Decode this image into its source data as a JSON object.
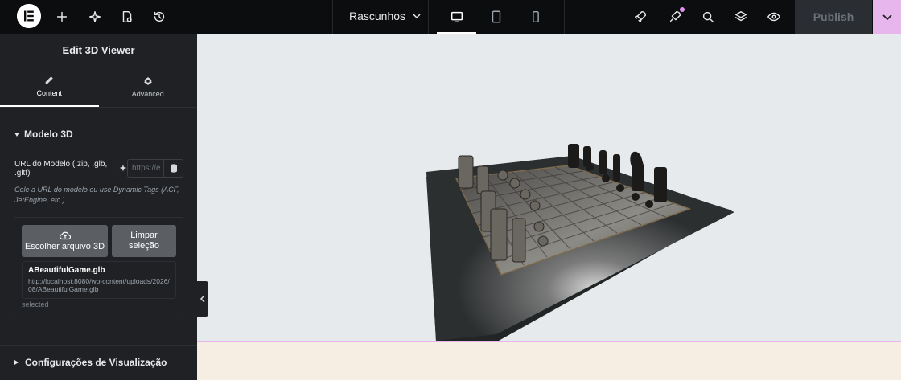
{
  "topbar": {
    "drafts_label": "Rascunhos",
    "publish_label": "Publish",
    "icons": [
      "elementor-logo-icon",
      "add-icon",
      "ai-sparkle-icon",
      "page-settings-icon",
      "history-icon",
      "drafts-chevron-icon",
      "desktop-icon",
      "tablet-icon",
      "mobile-icon",
      "rocket-icon",
      "notifications-icon",
      "search-icon",
      "layers-icon",
      "preview-eye-icon",
      "chevron-down-icon"
    ],
    "active_device": "desktop",
    "publish_more_color": "#e7b6ec"
  },
  "panel": {
    "title": "Edit 3D Viewer",
    "tabs": [
      {
        "label": "Content",
        "icon": "pencil-icon",
        "active": true
      },
      {
        "label": "Advanced",
        "icon": "gear-icon",
        "active": false
      }
    ],
    "section_title": "Modelo 3D",
    "url_label": "URL do Modelo (.zip, .glb, .gltf)",
    "url_placeholder": "https://e",
    "help_text": "Cole a URL do modelo ou use Dynamic Tags (ACF, JetEngine, etc.)",
    "choose_button": "Escolher arquivo 3D",
    "clear_button": "Limpar seleção",
    "file_name": "ABeautifulGame.glb",
    "file_path": "http://localhost:8080/wp-content/uploads/2026/08/ABeautifulGame.glb",
    "selected_label": "selected",
    "section2_title": "Configurações de Visualização"
  },
  "canvas": {
    "model_description": "chess-board-3d-model",
    "background": "#e7eaed",
    "footer_color": "#f6eee2"
  }
}
